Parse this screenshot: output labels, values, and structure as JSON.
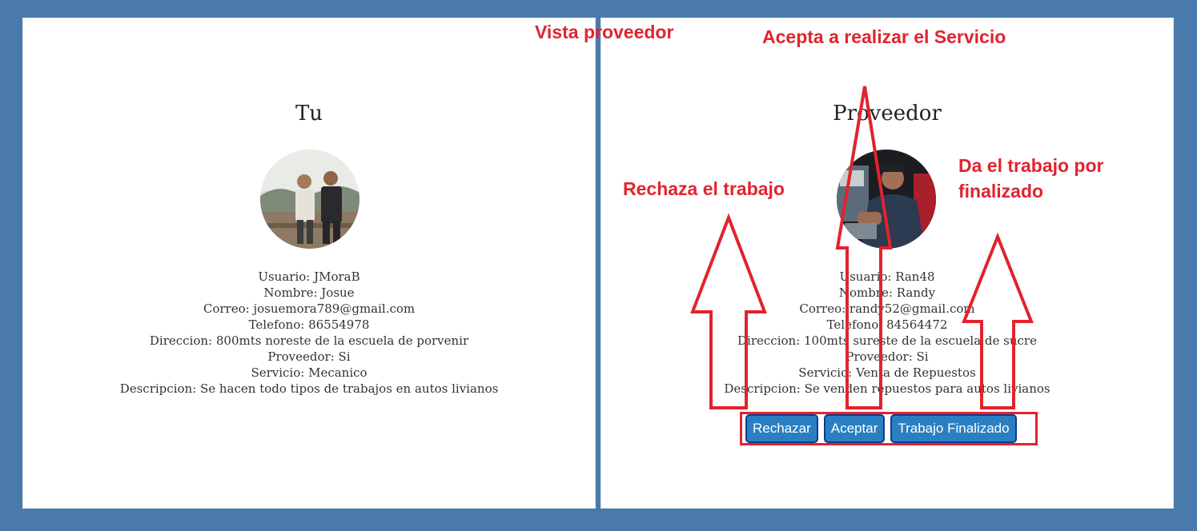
{
  "annotations": {
    "view_label": "Vista proveedor",
    "accept_note": "Acepta a realizar el Servicio",
    "reject_note": "Rechaza el trabajo",
    "finish_note_line1": "Da el trabajo por",
    "finish_note_line2": "finalizado"
  },
  "left_panel": {
    "title": "Tu",
    "usuario": "Usuario: JMoraB",
    "nombre": "Nombre: Josue",
    "correo": "Correo: josuemora789@gmail.com",
    "telefono": "Telefono: 86554978",
    "direccion": "Direccion: 800mts noreste de la escuela de porvenir",
    "proveedor": "Proveedor: Si",
    "servicio": "Servicio: Mecanico",
    "descripcion": "Descripcion: Se hacen todo tipos de trabajos en autos livianos"
  },
  "right_panel": {
    "title": "Proveedor",
    "usuario": "Usuario: Ran48",
    "nombre": "Nombre: Randy",
    "correo": "Correo: randy52@gmail.com",
    "telefono": "Telefono: 84564472",
    "direccion": "Direccion: 100mts sureste de la escuela de sucre",
    "proveedor": "Proveedor: Si",
    "servicio": "Servicio: Venta de Repuestos",
    "descripcion": "Descripcion: Se venden repuestos para autos livianos"
  },
  "buttons": {
    "reject": "Rechazar",
    "accept": "Aceptar",
    "finish": "Trabajo Finalizado"
  },
  "colors": {
    "background": "#4a7aab",
    "annotation_red": "#e0242d",
    "button_fill": "#2a7fc2",
    "button_border": "#0d3c8f"
  }
}
